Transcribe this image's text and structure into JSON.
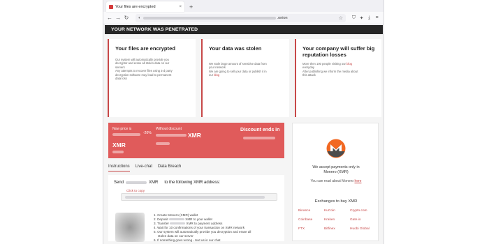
{
  "browser": {
    "tab_title": "Your files are encrypted",
    "tab_close": "×",
    "new_tab": "+",
    "url_suffix": ".onion",
    "back": "←",
    "forward": "→",
    "reload": "↻"
  },
  "banner": "YOUR NETWORK WAS PENETRATED",
  "cards": [
    {
      "title": "Your files are encrypted",
      "lines": [
        "Our system will automatically provide you",
        "decryptor and erase all stolen data on our",
        "servers",
        "Any attempts to recover files using 3-d party",
        "decryption software may lead to permanent",
        "data loss"
      ]
    },
    {
      "title": "Your data was stolen",
      "lines": [
        "We stole large amount of sensitive data from",
        "your network",
        "We are going to sell your data or publish it in",
        "our "
      ],
      "link": "blog"
    },
    {
      "title": "Your company will suffer big reputation losses",
      "lines": [
        "More then 100 people visiting our ",
        "everyday",
        "After publishing we inform the media about",
        "this attack"
      ],
      "link": "blog"
    }
  ],
  "price": {
    "now_label": "Now price is",
    "discount_pct": "-20%",
    "without_label": "Without discount",
    "currency": "XMR",
    "currency_left": "XMR",
    "ends_label": "Discount ends in"
  },
  "tabs": [
    "Instructions",
    "Live-chat",
    "Data Breach"
  ],
  "instructions": {
    "send": "Send",
    "xmr": "XMR",
    "to_address": "to the following XMR address:",
    "click_to_copy": "Click to copy",
    "steps": [
      "1. Create Monero (XMR) wallet",
      "2. Deposit",
      "XMR to your wallet",
      "3. Transfer",
      "XMR to payment address",
      "4. Wait for 10 confirmations of your transaction on XMR network",
      "5. Our system will automatically provide you decryption and erase all",
      "stolen data on our server",
      "6. If something goes wrong - text us in our chat"
    ]
  },
  "payment": {
    "accept_line1": "We accept payments only in",
    "accept_line2": "Monero (XMR)",
    "read_more": "You can read about Monero ",
    "here": "here",
    "exchanges_title": "Exchanges to buy XMR",
    "exchanges": [
      "Binance",
      "KuCoin",
      "Crypto.com",
      "Coinbase",
      "Kraken",
      "Gate.io",
      "FTX",
      "Bitfinex",
      "Huobi Global"
    ]
  },
  "colors": {
    "accent": "#c74848",
    "price_bg": "#e05b5b",
    "banner_bg": "#262626"
  }
}
